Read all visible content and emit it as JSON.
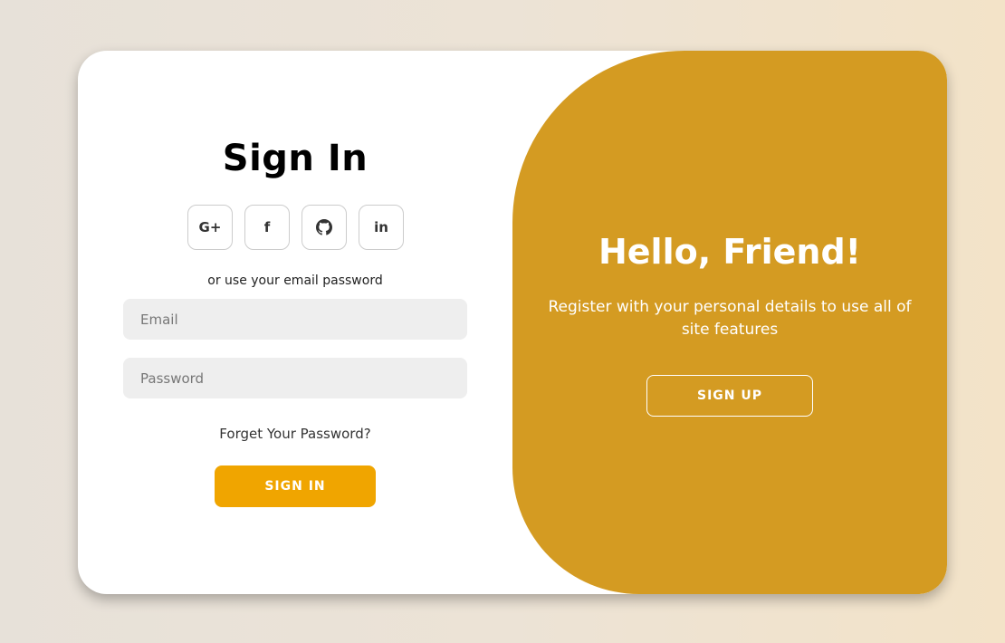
{
  "signin": {
    "title": "Sign In",
    "socials": [
      {
        "icon": "google-plus-icon",
        "label": "G+"
      },
      {
        "icon": "facebook-icon",
        "label": "f"
      },
      {
        "icon": "github-icon",
        "label": ""
      },
      {
        "icon": "linkedin-icon",
        "label": "in"
      }
    ],
    "subtext": "or use your email password",
    "email_placeholder": "Email",
    "password_placeholder": "Password",
    "forgot": "Forget Your Password?",
    "button": "SIGN IN"
  },
  "panel": {
    "title": "Hello, Friend!",
    "text": "Register with your personal details to use all of site features",
    "button": "SIGN UP"
  },
  "colors": {
    "accent": "#f0a500",
    "panel": "#d49b22",
    "input_bg": "#eeeeee"
  }
}
